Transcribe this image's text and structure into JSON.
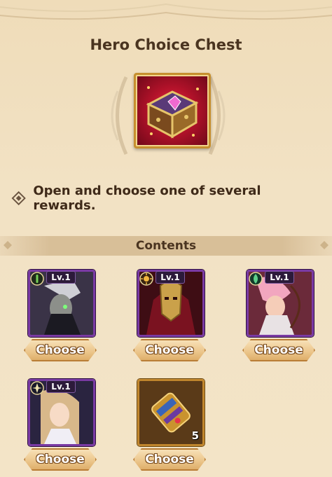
{
  "title": "Hero Choice Chest",
  "description": "Open and choose one of several rewards.",
  "contents_label": "Contents",
  "items": [
    {
      "level": "Lv.1",
      "choose_label": "Choose"
    },
    {
      "level": "Lv.1",
      "choose_label": "Choose"
    },
    {
      "level": "Lv.1",
      "choose_label": "Choose"
    },
    {
      "level": "Lv.1",
      "choose_label": "Choose"
    },
    {
      "quantity": "5",
      "choose_label": "Choose"
    }
  ],
  "colors": {
    "accent_purple": "#7a3aa4",
    "accent_gold": "#c1862d",
    "chest_red": "#b3122a",
    "panel_bg": "#f2e2c4"
  }
}
